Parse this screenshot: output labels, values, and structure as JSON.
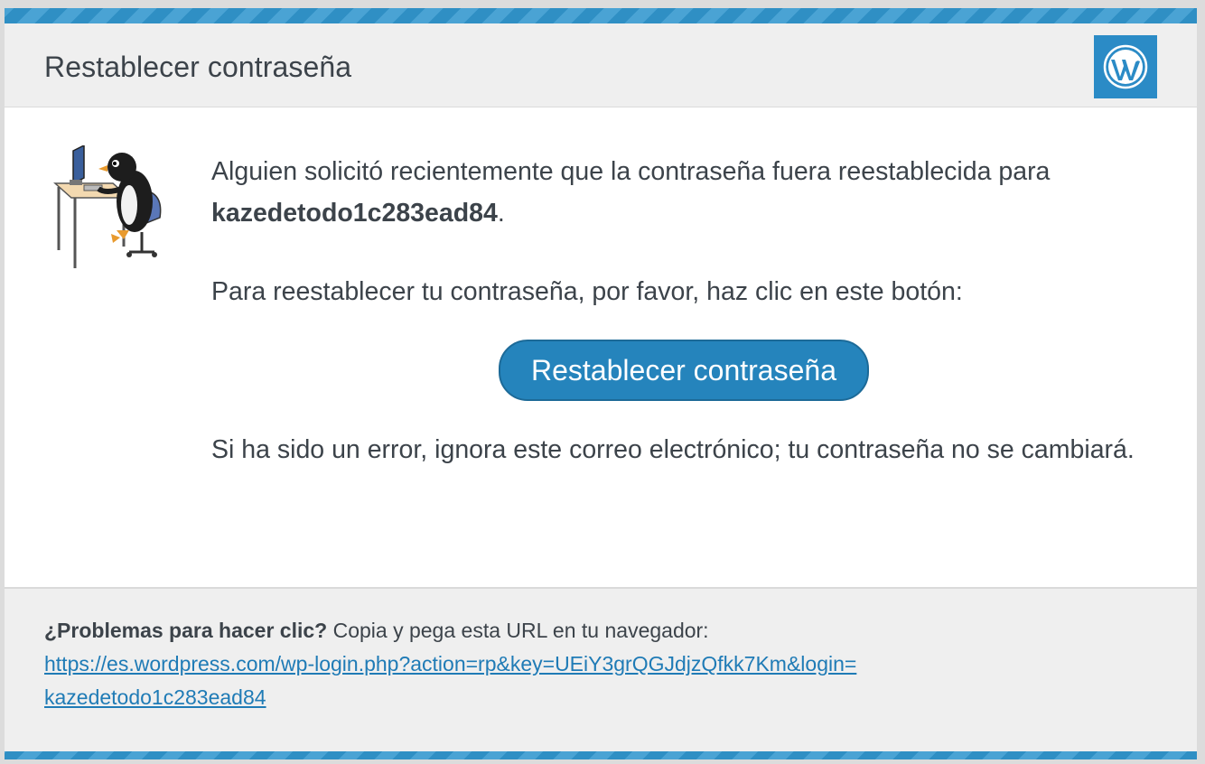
{
  "header": {
    "title": "Restablecer contraseña",
    "logo_icon": "wordpress-logo-icon"
  },
  "body": {
    "mascot_icon": "penguin-at-computer-icon",
    "intro_text": "Alguien solicitó recientemente que la contraseña fuera reestablecida para",
    "username": "kazedetodo1c283ead84",
    "period": ".",
    "instruction": "Para reestablecer tu contraseña, por favor, haz clic en este botón:",
    "button_label": "Restablecer contraseña",
    "ignore_text": "Si ha sido un error, ignora este correo electrónico; tu contraseña no se cambiará."
  },
  "footer": {
    "trouble_bold": "¿Problemas para hacer clic?",
    "trouble_text": " Copia y pega esta URL en tu navegador:",
    "url_line1": "https://es.wordpress.com/wp-login.php?action=rp&key=UEiY3grQGJdjzQfkk7Km&login=",
    "url_line2": "kazedetodo1c283ead84"
  },
  "colors": {
    "accent": "#2584bc",
    "stripe_dark": "#2f8fc4",
    "stripe_light": "#4aa3d4",
    "link": "#1f7bb6",
    "header_bg": "#efefef",
    "text": "#3c434a"
  }
}
